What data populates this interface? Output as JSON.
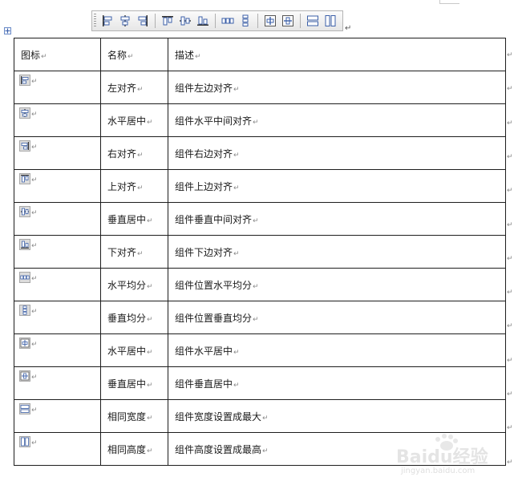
{
  "toolbar": {
    "buttons": [
      {
        "icon": "align-left-icon"
      },
      {
        "icon": "align-center-horizontal-icon"
      },
      {
        "icon": "align-right-icon"
      },
      {
        "icon": "align-top-icon"
      },
      {
        "icon": "align-middle-vertical-icon"
      },
      {
        "icon": "align-bottom-icon"
      },
      {
        "icon": "distribute-horizontal-icon"
      },
      {
        "icon": "distribute-vertical-icon"
      },
      {
        "icon": "center-horizontal-icon"
      },
      {
        "icon": "center-vertical-icon"
      },
      {
        "icon": "same-width-icon"
      },
      {
        "icon": "same-height-icon"
      }
    ]
  },
  "table": {
    "headers": {
      "icon": "图标",
      "name": "名称",
      "desc": "描述"
    },
    "rows": [
      {
        "icon": "align-left-icon",
        "name": "左对齐",
        "desc": "组件左边对齐"
      },
      {
        "icon": "align-center-horizontal-icon",
        "name": "水平居中",
        "desc": "组件水平中间对齐"
      },
      {
        "icon": "align-right-icon",
        "name": "右对齐",
        "desc": "组件右边对齐"
      },
      {
        "icon": "align-top-icon",
        "name": "上对齐",
        "desc": "组件上边对齐"
      },
      {
        "icon": "align-middle-vertical-icon",
        "name": "垂直居中",
        "desc": "组件垂直中间对齐"
      },
      {
        "icon": "align-bottom-icon",
        "name": "下对齐",
        "desc": "组件下边对齐"
      },
      {
        "icon": "distribute-horizontal-icon",
        "name": "水平均分",
        "desc": "组件位置水平均分"
      },
      {
        "icon": "distribute-vertical-icon",
        "name": "垂直均分",
        "desc": "组件位置垂直均分"
      },
      {
        "icon": "center-horizontal-icon",
        "name": "水平居中",
        "desc": "组件水平居中"
      },
      {
        "icon": "center-vertical-icon",
        "name": "垂直居中",
        "desc": "组件垂直居中"
      },
      {
        "icon": "same-width-icon",
        "name": "相同宽度",
        "desc": "组件宽度设置成最大"
      },
      {
        "icon": "same-height-icon",
        "name": "相同高度",
        "desc": "组件高度设置成最高"
      }
    ]
  },
  "paragraph_mark": "↵",
  "watermark": {
    "main": "Baidu经验",
    "sub": "jingyan.baidu.com"
  },
  "colors": {
    "icon_blue": "#3b5fa8",
    "icon_bg": "#dcdcdc",
    "border": "#1e1e1e"
  }
}
